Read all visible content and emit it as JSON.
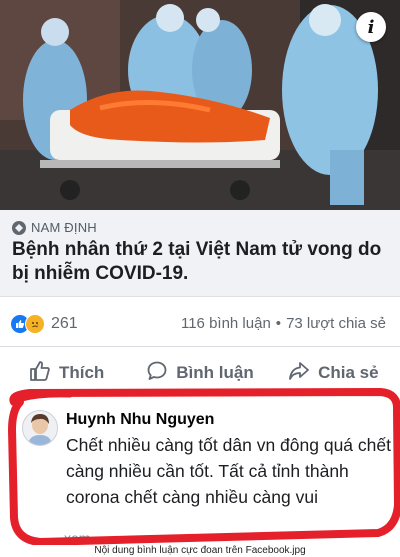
{
  "photo": {
    "info_icon": "i",
    "info_icon_name": "info-icon"
  },
  "post": {
    "location": "NAM ĐỊNH",
    "headline": "Bệnh nhân thứ 2 tại Việt Nam tử vong do bị nhiễm COVID-19."
  },
  "stats": {
    "reaction_icons": [
      "like-icon",
      "sad-icon"
    ],
    "reaction_count": "261",
    "comments": "116 bình luận",
    "separator": "•",
    "shares": "73 lượt chia sẻ"
  },
  "actions": {
    "like": "Thích",
    "comment": "Bình luận",
    "share": "Chia sẻ"
  },
  "comment": {
    "author": "Huynh Nhu Nguyen",
    "text": "Chết nhiều càng tốt dân vn đông quá chết càng nhiều cần tốt. Tất cả tỉnh thành  corona chết càng nhiều càng vui",
    "truncated_line": "xem"
  },
  "caption": "Nội dung bình luận cực đoan trên Facebook.jpg",
  "colors": {
    "highlight_ring": "#e4202a",
    "brand_blue": "#1877f2",
    "secondary_text": "#606770"
  }
}
